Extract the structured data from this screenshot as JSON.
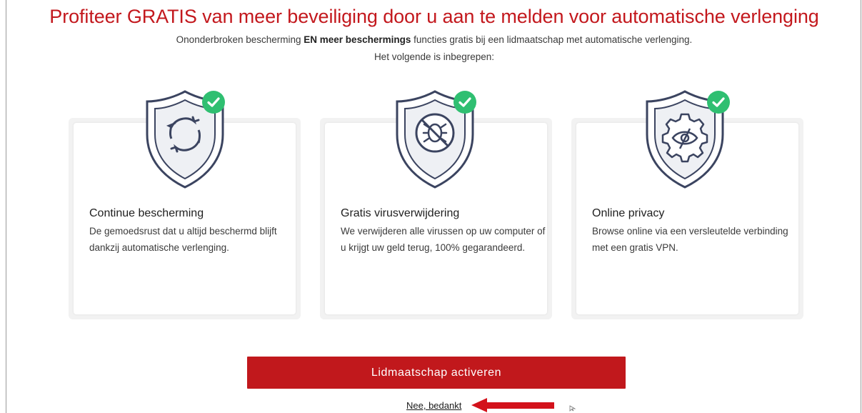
{
  "header": {
    "title": "Profiteer GRATIS van meer beveiliging door u aan te melden voor automatische verlenging",
    "subtitle_pre": "Ononderbroken bescherming ",
    "subtitle_bold": "EN meer beschermings",
    "subtitle_post": " functies gratis bij een lidmaatschap met automatische verlenging.",
    "included_label": "Het volgende is inbegrepen:"
  },
  "features": [
    {
      "icon": "sync-shield-icon",
      "title": "Continue bescherming",
      "text": "De gemoedsrust dat u altijd beschermd blijft dankzij automatische verlenging."
    },
    {
      "icon": "no-virus-shield-icon",
      "title": "Gratis virusverwijdering",
      "text": "We verwijderen alle virussen op uw computer of u krijgt uw geld terug, 100% gegarandeerd."
    },
    {
      "icon": "privacy-gear-shield-icon",
      "title": "Online privacy",
      "text": "Browse online via een versleutelde verbinding met een gratis VPN."
    }
  ],
  "actions": {
    "activate_label": "Lidmaatschap activeren",
    "decline_label": "Nee, bedankt"
  },
  "colors": {
    "brand_red": "#c3181d",
    "check_green": "#2fbf71",
    "shield_stroke": "#3b4460"
  }
}
